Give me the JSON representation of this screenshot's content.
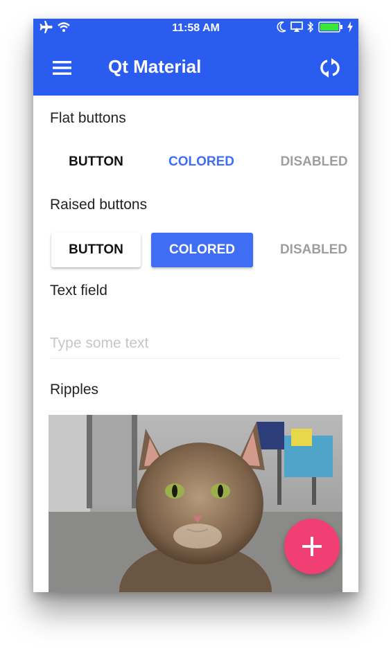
{
  "status_bar": {
    "time": "11:58 AM",
    "left_icons": [
      "airplane-icon",
      "wifi-icon"
    ],
    "right_icons": [
      "moon-icon",
      "airplay-icon",
      "bluetooth-icon",
      "battery-icon",
      "charging-bolt-icon"
    ]
  },
  "app_bar": {
    "title": "Qt Material",
    "menu_icon": "hamburger-menu-icon",
    "action_icon": "refresh-icon",
    "color": "#2b5cf0"
  },
  "flat_buttons": {
    "label": "Flat buttons",
    "buttons": [
      {
        "label": "BUTTON",
        "color": "#111111"
      },
      {
        "label": "COLORED",
        "color": "#3f6ef5"
      },
      {
        "label": "DISABLED",
        "color": "#9e9e9e"
      }
    ]
  },
  "raised_buttons": {
    "label": "Raised buttons",
    "buttons": [
      {
        "label": "BUTTON"
      },
      {
        "label": "COLORED",
        "background": "#3f6ef5"
      },
      {
        "label": "DISABLED"
      }
    ]
  },
  "text_field": {
    "label": "Text field",
    "placeholder": "Type some text",
    "value": ""
  },
  "ripples": {
    "label": "Ripples",
    "image": "cat-photo"
  },
  "fab": {
    "icon": "plus-icon",
    "color": "#f23f73"
  }
}
